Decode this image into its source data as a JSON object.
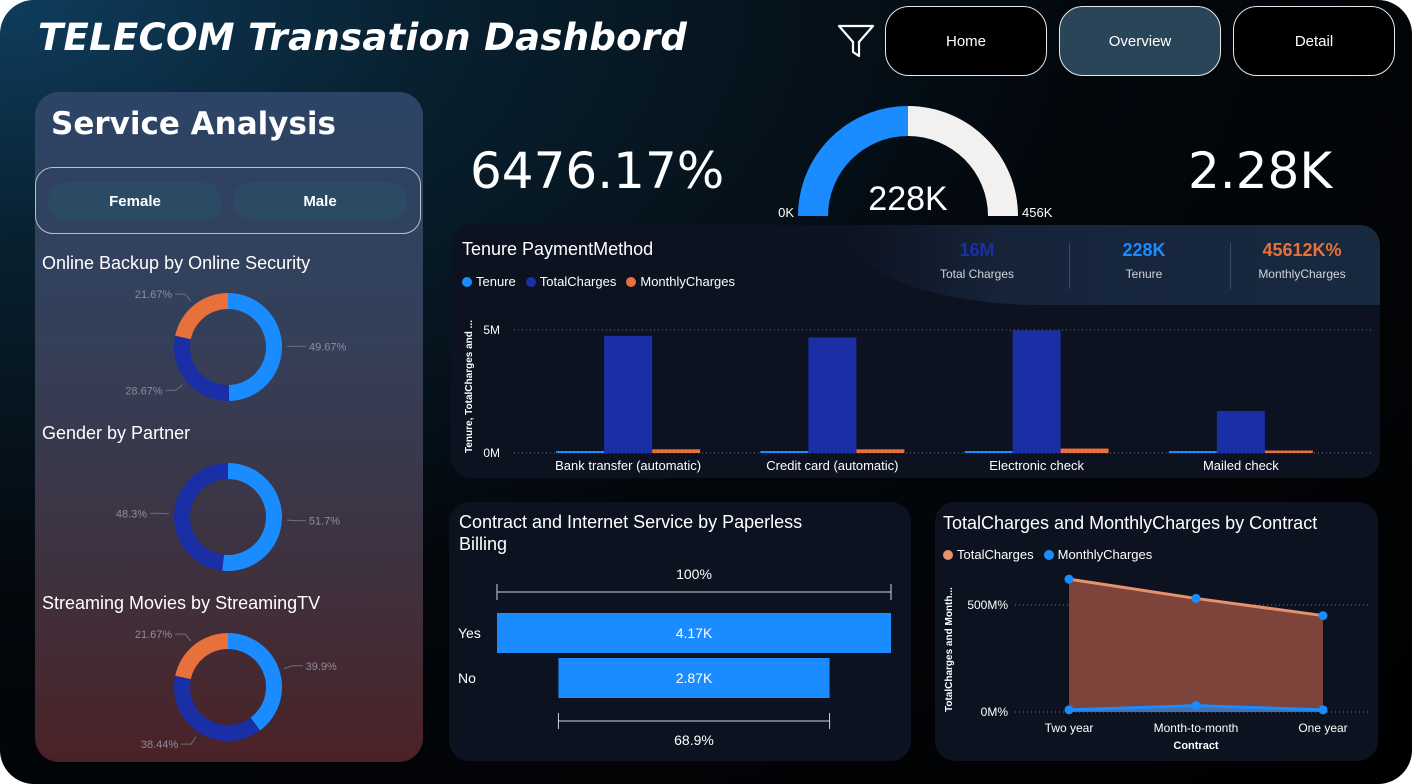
{
  "header": {
    "title": "TELECOM Transation Dashbord",
    "nav": [
      {
        "label": "Home",
        "active": false
      },
      {
        "label": "Overview",
        "active": true
      },
      {
        "label": "Detail",
        "active": false
      }
    ]
  },
  "colors": {
    "blue": "#1a8cff",
    "navy": "#1a2ea6",
    "orange": "#e8703a",
    "accent_button": "#2a4458"
  },
  "service_panel": {
    "title": "Service Analysis",
    "slicer": [
      "Female",
      "Male"
    ]
  },
  "kpis": {
    "left": "6476.17%",
    "right": "2.28K"
  },
  "tenure_panel": {
    "title": "Tenure PaymentMethod",
    "cards": [
      {
        "value": "16M",
        "label": "Total Charges"
      },
      {
        "value": "228K",
        "label": "Tenure"
      },
      {
        "value": "45612K%",
        "label": "MonthlyCharges"
      }
    ]
  },
  "chart_data": [
    {
      "type": "pie",
      "title": "Online Backup by Online Security",
      "donut": true,
      "slices": [
        {
          "label": "49.67%",
          "value": 49.67,
          "color": "#1a8cff"
        },
        {
          "label": "28.67%",
          "value": 28.67,
          "color": "#1a2ea6"
        },
        {
          "label": "21.67%",
          "value": 21.67,
          "color": "#e8703a"
        }
      ]
    },
    {
      "type": "pie",
      "title": "Gender by Partner",
      "donut": true,
      "slices": [
        {
          "label": "51.7%",
          "value": 51.7,
          "color": "#1a8cff"
        },
        {
          "label": "48.3%",
          "value": 48.3,
          "color": "#1a2ea6"
        }
      ]
    },
    {
      "type": "pie",
      "title": "Streaming Movies by StreamingTV",
      "donut": true,
      "slices": [
        {
          "label": "39.9%",
          "value": 39.9,
          "color": "#1a8cff"
        },
        {
          "label": "38.44%",
          "value": 38.44,
          "color": "#1a2ea6"
        },
        {
          "label": "21.67%",
          "value": 21.67,
          "color": "#e8703a"
        }
      ]
    },
    {
      "type": "gauge",
      "value": 228,
      "min": 0,
      "max": 456,
      "value_label": "228K",
      "min_label": "0K",
      "max_label": "456K"
    },
    {
      "type": "bar",
      "categories": [
        "Bank transfer (automatic)",
        "Credit card (automatic)",
        "Electronic check",
        "Mailed check"
      ],
      "series": [
        {
          "name": "Tenure",
          "values": [
            0.05,
            0.05,
            0.05,
            0.05
          ],
          "color": "#1a8cff"
        },
        {
          "name": "TotalCharges",
          "values": [
            4.76,
            4.7,
            4.98,
            1.71
          ],
          "color": "#1a2ea6"
        },
        {
          "name": "MonthlyCharges",
          "values": [
            0.15,
            0.15,
            0.18,
            0.1
          ],
          "color": "#e8703a"
        }
      ],
      "unit": "M",
      "xlabel": "PaymentMethod",
      "ylabel": "Tenure, TotalCharges and ...",
      "yticks": [
        "0M",
        "5M"
      ],
      "ylim": [
        0,
        5
      ],
      "legend": "top-left"
    },
    {
      "type": "bar",
      "orientation": "horizontal",
      "title": "Contract and Internet Service by Paperless Billing",
      "categories": [
        "Yes",
        "No"
      ],
      "values": [
        4.17,
        2.87
      ],
      "value_labels": [
        "4.17K",
        "2.87K"
      ],
      "top_pct": "100%",
      "bottom_pct": "68.9%",
      "color": "#1a8cff"
    },
    {
      "type": "area",
      "title": "TotalCharges and MonthlyCharges by Contract",
      "categories": [
        "Two year",
        "Month-to-month",
        "One year"
      ],
      "series": [
        {
          "name": "TotalCharges",
          "values": [
            620,
            530,
            450
          ],
          "color": "#e8916a"
        },
        {
          "name": "MonthlyCharges",
          "values": [
            10,
            30,
            10
          ],
          "color": "#1a8cff"
        }
      ],
      "xlabel": "Contract",
      "ylabel": "TotalCharges and Month...",
      "yticks": [
        "0M%",
        "500M%"
      ],
      "ylim": [
        0,
        700
      ],
      "legend": "top-left"
    }
  ]
}
